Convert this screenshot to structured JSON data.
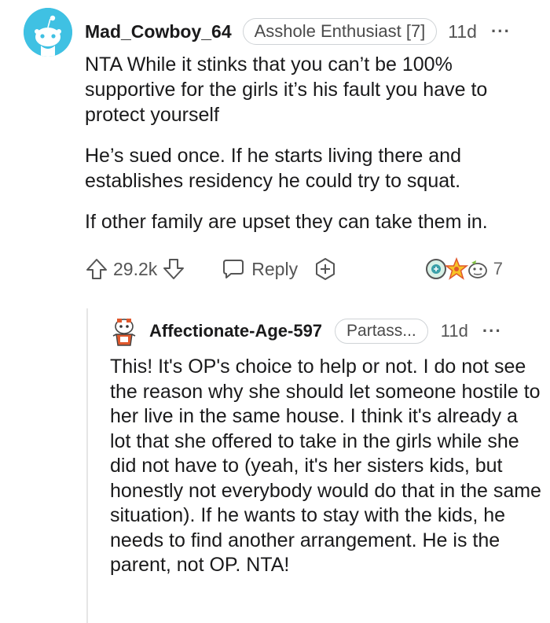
{
  "comment": {
    "username": "Mad_Cowboy_64",
    "flair": "Asshole Enthusiast [7]",
    "age": "11d",
    "more_icon": "···",
    "paragraphs": [
      "NTA While it stinks that you can’t be 100% supportive for the girls it’s his fault you have to protect yourself",
      "He’s sued once. If he starts living there and establishes residency he could try to squat.",
      "If other family are upset they can take them in."
    ],
    "votes": "29.2k",
    "reply_label": "Reply",
    "award_count": "7",
    "avatar_color": "#3fc1e3"
  },
  "reply": {
    "username": "Affectionate-Age-597",
    "flair": "Partass...",
    "age": "11d",
    "more_icon": "···",
    "body": "This! It's OP's choice to help or not. I do not see the reason why she should let someone hostile to her live in the same house. I think it's already a lot that she offered to take in the girls while she did not have to (yeah, it's her sisters kids, but honestly not everybody would do that in the same situation). If he wants to stay with the kids, he needs to find another arrangement. He is the parent, not OP. NTA!"
  }
}
